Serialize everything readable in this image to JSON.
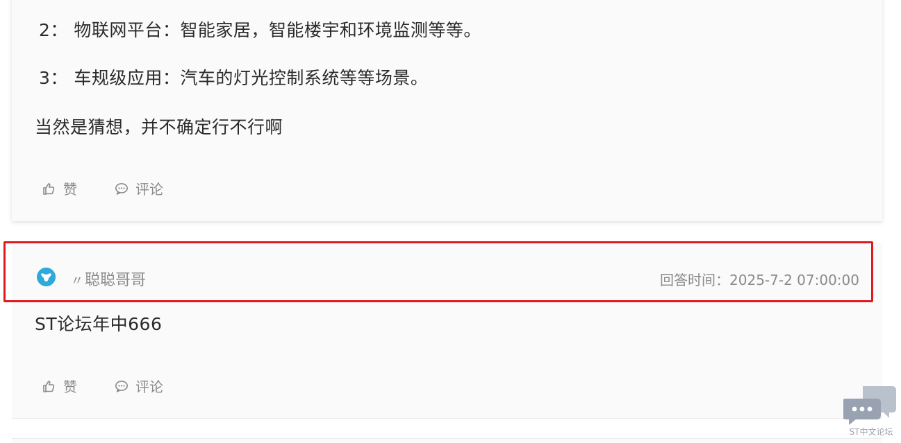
{
  "answer1": {
    "lines": [
      "2： 物联网平台：智能家居，智能楼宇和环境监测等等。",
      "3： 车规级应用：汽车的灯光控制系统等等场景。",
      "当然是猜想，并不确定行不行啊"
    ],
    "like_label": "赞",
    "comment_label": "评论"
  },
  "answer2": {
    "user_prefix": "〃",
    "username": "聪聪哥哥",
    "answer_time": "回答时间：2025-7-2 07:00:00",
    "content": "ST论坛年中666",
    "like_label": "赞",
    "comment_label": "评论"
  },
  "forum_badge": {
    "label": "ST中文论坛"
  },
  "colors": {
    "highlight": "#e0191f",
    "avatar": "#2fa9dc",
    "muted_text": "#8a8a8a",
    "badge": "#9aa3b2"
  }
}
